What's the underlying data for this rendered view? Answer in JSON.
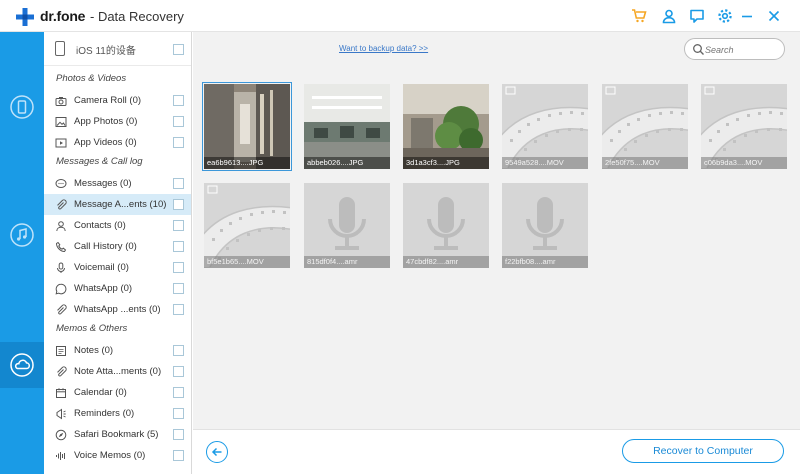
{
  "app": {
    "brand": "dr.fone",
    "title": "- Data Recovery",
    "accent": "#1a9be6",
    "cart_color": "#f5a623"
  },
  "titlebar_icons": [
    "cart-icon",
    "user-icon",
    "feedback-icon",
    "gear-icon",
    "minimize-icon",
    "close-icon"
  ],
  "rail": [
    {
      "name": "phone-recover-icon"
    },
    {
      "name": "itunes-recover-icon"
    },
    {
      "name": "icloud-recover-icon",
      "active": true
    }
  ],
  "device": {
    "name": "iOS 11的设备"
  },
  "sections": [
    {
      "title": "Photos & Videos",
      "items": [
        {
          "label": "Camera Roll (0)",
          "icon": "camera-icon"
        },
        {
          "label": "App Photos (0)",
          "icon": "image-icon"
        },
        {
          "label": "App Videos (0)",
          "icon": "video-icon"
        }
      ]
    },
    {
      "title": "Messages & Call log",
      "items": [
        {
          "label": "Messages (0)",
          "icon": "message-icon"
        },
        {
          "label": "Message A...ents (10)",
          "icon": "paperclip-icon",
          "selected": true
        },
        {
          "label": "Contacts (0)",
          "icon": "contact-icon"
        },
        {
          "label": "Call History (0)",
          "icon": "phone-icon"
        },
        {
          "label": "Voicemail (0)",
          "icon": "voicemail-icon"
        },
        {
          "label": "WhatsApp (0)",
          "icon": "whatsapp-icon"
        },
        {
          "label": "WhatsApp ...ents (0)",
          "icon": "paperclip-icon"
        }
      ]
    },
    {
      "title": "Memos & Others",
      "items": [
        {
          "label": "Notes (0)",
          "icon": "note-icon"
        },
        {
          "label": "Note Atta...ments (0)",
          "icon": "paperclip-icon"
        },
        {
          "label": "Calendar (0)",
          "icon": "calendar-icon"
        },
        {
          "label": "Reminders (0)",
          "icon": "reminder-icon"
        },
        {
          "label": "Safari Bookmark (5)",
          "icon": "compass-icon"
        },
        {
          "label": "Voice Memos (0)",
          "icon": "waveform-icon"
        }
      ]
    }
  ],
  "main": {
    "backup_link": "Want to backup data? >>",
    "search_placeholder": "Search",
    "recover_label": "Recover to Computer"
  },
  "thumbnails": [
    {
      "caption": "ea6b9613....JPG",
      "kind": "photo-corridor",
      "selected": true
    },
    {
      "caption": "abbeb026....JPG",
      "kind": "photo-office"
    },
    {
      "caption": "3d1a3cf3....JPG",
      "kind": "photo-plant"
    },
    {
      "caption": "9549a528....MOV",
      "kind": "video"
    },
    {
      "caption": "2fe50f75....MOV",
      "kind": "video"
    },
    {
      "caption": "c06b9da3....MOV",
      "kind": "video"
    },
    {
      "caption": "bf5e1b65....MOV",
      "kind": "video"
    },
    {
      "caption": "815df0f4....amr",
      "kind": "audio"
    },
    {
      "caption": "47cbdf82....amr",
      "kind": "audio"
    },
    {
      "caption": "f22bfb08....amr",
      "kind": "audio"
    }
  ]
}
